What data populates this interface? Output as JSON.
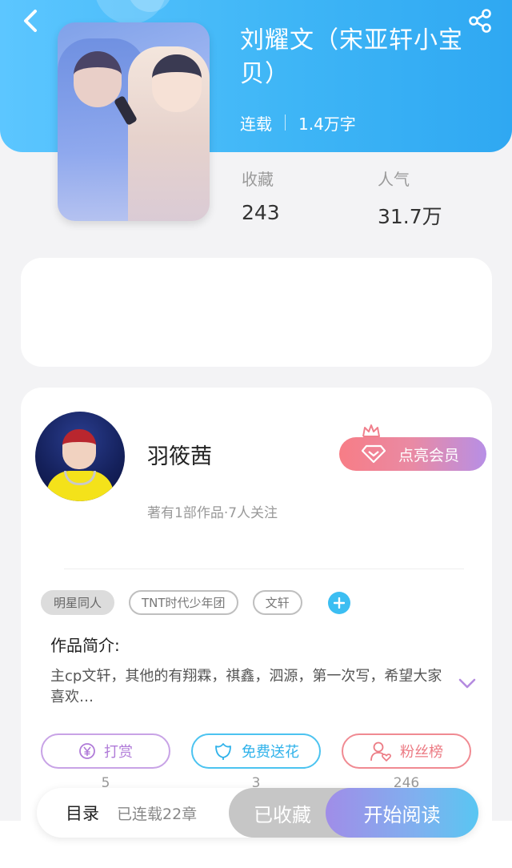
{
  "header": {
    "title": "刘耀文（宋亚轩小宝贝）",
    "status": "连载",
    "word_count": "1.4万字",
    "stats": [
      {
        "label": "收藏",
        "value": "243"
      },
      {
        "label": "人气",
        "value": "31.7万"
      }
    ]
  },
  "author": {
    "name": "羽筱茜",
    "subtitle": "著有1部作品·7人关注",
    "vip_label": "点亮会员"
  },
  "tags": [
    "明星同人",
    "TNT时代少年团",
    "文轩"
  ],
  "intro": {
    "title": "作品简介:",
    "text": "主cp文轩，其他的有翔霖，祺鑫，泗源，第一次写，希望大家喜欢…"
  },
  "actions": [
    {
      "label": "打赏",
      "count": "5"
    },
    {
      "label": "免费送花",
      "count": "3"
    },
    {
      "label": "粉丝榜",
      "count": "246"
    }
  ],
  "bottom": {
    "toc_label": "目录",
    "chapters": "已连载22章",
    "fav_label": "已收藏",
    "read_label": "开始阅读"
  },
  "colors": {
    "header": "#3fb6f6",
    "accent_blue": "#3cbef2",
    "accent_purple": "#b07bd8",
    "accent_pink": "#ec7b84"
  }
}
